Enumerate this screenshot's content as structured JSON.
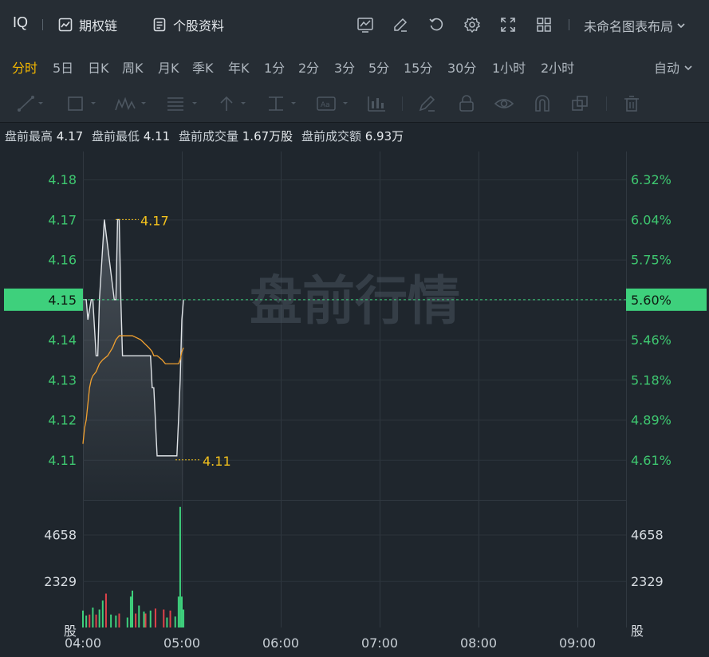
{
  "header": {
    "ticker": "IQ",
    "options_chain_label": "期权链",
    "stock_profile_label": "个股资料",
    "layout_label": "未命名图表布局"
  },
  "periods": {
    "tabs": [
      "分时",
      "5日",
      "日K",
      "周K",
      "月K",
      "季K",
      "年K",
      "1分",
      "2分",
      "3分",
      "5分",
      "15分",
      "30分",
      "1小时",
      "2小时"
    ],
    "active": "分时",
    "auto_label": "自动"
  },
  "drawing_tools": [
    "line-tool-icon",
    "rectangle-tool-icon",
    "pattern-tool-icon",
    "fib-tool-icon",
    "arrow-tool-icon",
    "measure-tool-icon",
    "text-tool-icon",
    "indicator-tool-icon",
    "brush-icon",
    "lock-icon",
    "eye-icon",
    "magnet-icon",
    "layers-icon",
    "trash-icon"
  ],
  "info": {
    "high_label": "盘前最高",
    "high": "4.17",
    "low_label": "盘前最低",
    "low": "4.11",
    "volume_label": "盘前成交量",
    "volume": "1.67万股",
    "amount_label": "盘前成交额",
    "amount": "6.93万"
  },
  "watermark": "盘前行情",
  "chart_data": {
    "type": "line",
    "price_ticks": [
      "4.18",
      "4.17",
      "4.16",
      "4.15",
      "4.14",
      "4.13",
      "4.12",
      "4.11"
    ],
    "pct_ticks": [
      "6.32%",
      "6.04%",
      "5.75%",
      "5.60%",
      "5.46%",
      "5.18%",
      "4.89%",
      "4.61%"
    ],
    "current_price": "4.15",
    "current_pct": "5.60%",
    "high_marker": "4.17",
    "low_marker": "4.11",
    "volume_ticks": [
      "4658",
      "2329"
    ],
    "volume_unit": "股",
    "x_ticks": [
      "04:00",
      "05:00",
      "06:00",
      "07:00",
      "08:00",
      "09:00"
    ],
    "ylim": [
      4.1,
      4.187
    ],
    "volume_max": 6400,
    "price_series": {
      "name": "price",
      "minutes": [
        0,
        2,
        3,
        5,
        6,
        8,
        9,
        10,
        13,
        19,
        20,
        21,
        22,
        23,
        24,
        25,
        26,
        28,
        29,
        30,
        39,
        40,
        41,
        42,
        43,
        45,
        48,
        55,
        56,
        57,
        58,
        59,
        60,
        61
      ],
      "values": [
        4.15,
        4.15,
        4.145,
        4.15,
        4.15,
        4.136,
        4.136,
        4.15,
        4.17,
        4.15,
        4.15,
        4.17,
        4.17,
        4.15,
        4.136,
        4.136,
        4.136,
        4.136,
        4.136,
        4.136,
        4.136,
        4.136,
        4.136,
        4.128,
        4.128,
        4.111,
        4.111,
        4.111,
        4.111,
        4.111,
        4.12,
        4.13,
        4.145,
        4.15
      ]
    },
    "avg_series": {
      "name": "average",
      "minutes": [
        0,
        1,
        2,
        3,
        4,
        5,
        6,
        8,
        10,
        12,
        15,
        18,
        20,
        22,
        25,
        30,
        35,
        40,
        42,
        43,
        45,
        48,
        50,
        55,
        57,
        58,
        59,
        60,
        61
      ],
      "values": [
        4.114,
        4.118,
        4.12,
        4.124,
        4.128,
        4.13,
        4.131,
        4.132,
        4.134,
        4.135,
        4.136,
        4.138,
        4.14,
        4.141,
        4.141,
        4.141,
        4.14,
        4.138,
        4.137,
        4.136,
        4.136,
        4.135,
        4.134,
        4.134,
        4.134,
        4.134,
        4.135,
        4.137,
        4.138
      ]
    },
    "volume_bars": {
      "minutes": [
        0,
        2,
        4,
        6,
        8,
        10,
        12,
        14,
        17,
        20,
        22,
        27,
        29,
        30,
        32,
        34,
        37,
        38,
        41,
        44,
        49,
        51,
        53,
        56,
        58,
        59,
        60,
        61
      ],
      "values": [
        850,
        600,
        650,
        1000,
        650,
        900,
        1350,
        1700,
        650,
        600,
        700,
        500,
        1550,
        1850,
        700,
        1100,
        800,
        700,
        850,
        950,
        900,
        500,
        850,
        550,
        1550,
        6050,
        1550,
        900
      ],
      "up": [
        true,
        true,
        false,
        true,
        false,
        true,
        true,
        false,
        true,
        true,
        false,
        true,
        true,
        true,
        false,
        true,
        true,
        false,
        true,
        false,
        false,
        true,
        false,
        true,
        true,
        true,
        true,
        true
      ]
    }
  },
  "colors": {
    "up": "#3ed07c",
    "down": "#e0424a",
    "price_line": "#dfe3e7",
    "avg_line": "#f0a030",
    "marker": "#f4c21d",
    "axis_green": "#3ec870",
    "active_tab": "#f4b800"
  }
}
